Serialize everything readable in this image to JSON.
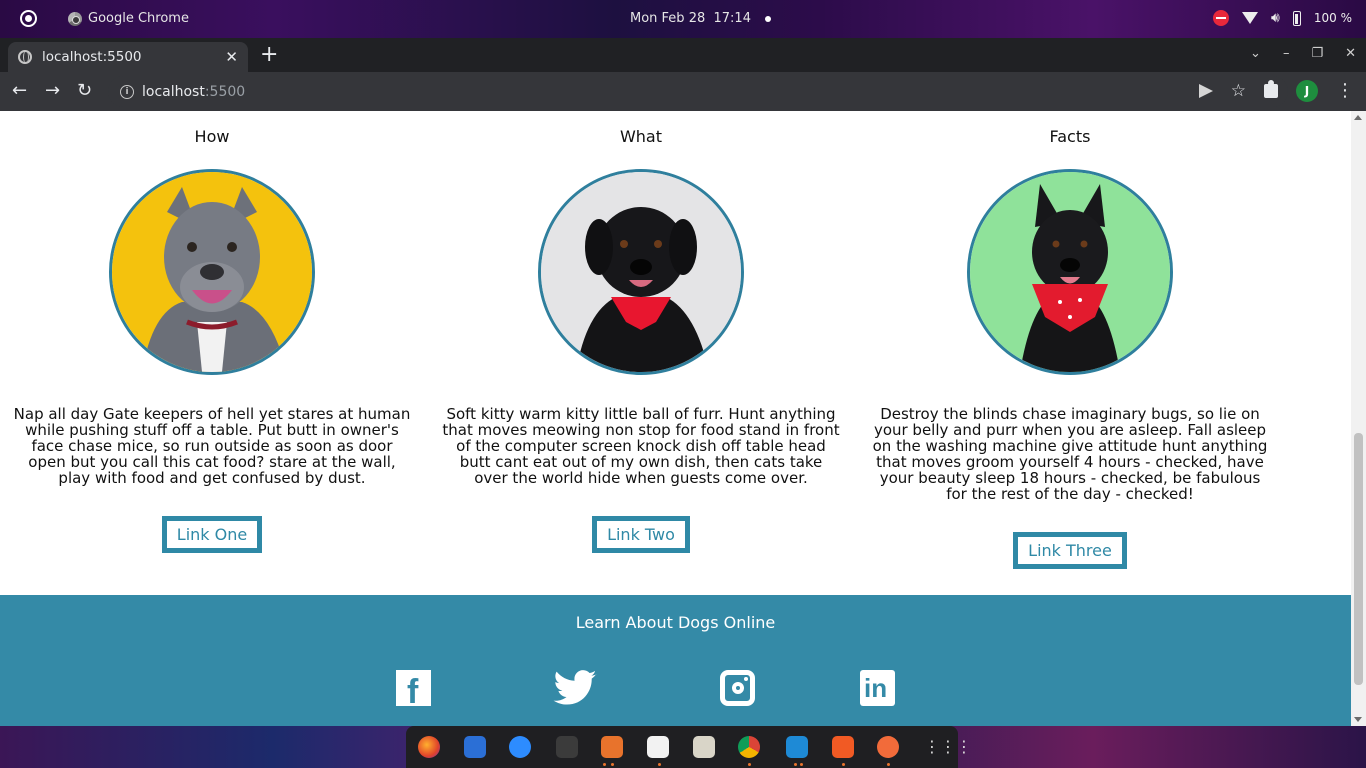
{
  "os": {
    "app_name": "Google Chrome",
    "clock": "Mon Feb 28  17:14",
    "battery": "100 %"
  },
  "browser": {
    "tab_title": "localhost:5500",
    "tab_close": "✕",
    "new_tab": "+",
    "url_host": "localhost",
    "url_port": ":5500",
    "profile_initial": "J"
  },
  "page": {
    "columns": [
      {
        "title": "How",
        "photo": "grey-pitbull-yellow-background",
        "text": "Nap all day Gate keepers of hell yet stares at human while pushing stuff off a table. Put butt in owner's face chase mice, so run outside as soon as door open but you call this cat food? stare at the wall, play with food and get confused by dust.",
        "link": "Link One"
      },
      {
        "title": "What",
        "photo": "black-dog-red-bandana-grey-background",
        "text": "Soft kitty warm kitty little ball of furr. Hunt anything that moves meowing non stop for food stand in front of the computer screen knock dish off table head butt cant eat out of my own dish, then cats take over the world hide when guests come over.",
        "link": "Link Two"
      },
      {
        "title": "Facts",
        "photo": "black-dog-red-bandana-green-background",
        "text": "Destroy the blinds chase imaginary bugs, so lie on your belly and purr when you are asleep. Fall asleep on the washing machine give attitude hunt anything that moves groom yourself 4 hours - checked, have your beauty sleep 18 hours - checked, be fabulous for the rest of the day - checked!",
        "link": "Link Three"
      }
    ],
    "footer": {
      "title": "Learn About Dogs Online",
      "social": [
        "facebook-icon",
        "twitter-icon",
        "instagram-icon",
        "linkedin-icon"
      ]
    },
    "colors": {
      "accent": "#348aa7",
      "link_border": "#2f89a6",
      "photo_border": "#2f7f9d"
    }
  }
}
